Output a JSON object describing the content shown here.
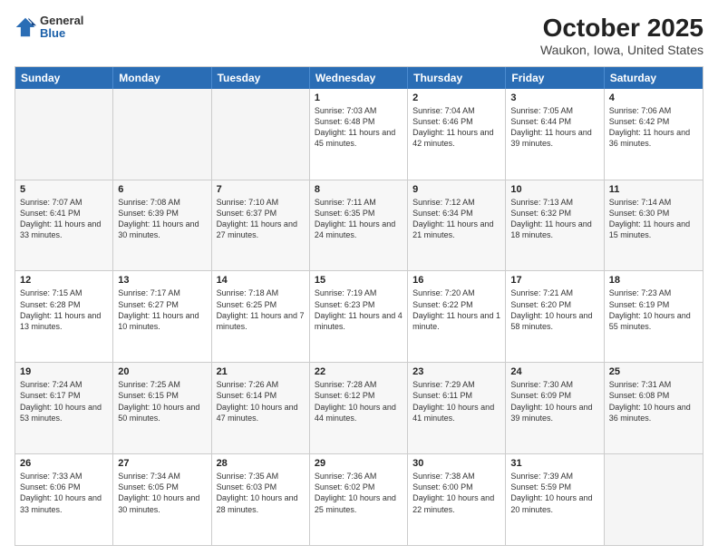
{
  "header": {
    "logo": {
      "general": "General",
      "blue": "Blue"
    },
    "title": "October 2025",
    "location": "Waukon, Iowa, United States"
  },
  "calendar": {
    "days_of_week": [
      "Sunday",
      "Monday",
      "Tuesday",
      "Wednesday",
      "Thursday",
      "Friday",
      "Saturday"
    ],
    "weeks": [
      [
        {
          "day": "",
          "empty": true
        },
        {
          "day": "",
          "empty": true
        },
        {
          "day": "",
          "empty": true
        },
        {
          "day": "1",
          "sunrise": "7:03 AM",
          "sunset": "6:48 PM",
          "daylight": "11 hours and 45 minutes."
        },
        {
          "day": "2",
          "sunrise": "7:04 AM",
          "sunset": "6:46 PM",
          "daylight": "11 hours and 42 minutes."
        },
        {
          "day": "3",
          "sunrise": "7:05 AM",
          "sunset": "6:44 PM",
          "daylight": "11 hours and 39 minutes."
        },
        {
          "day": "4",
          "sunrise": "7:06 AM",
          "sunset": "6:42 PM",
          "daylight": "11 hours and 36 minutes."
        }
      ],
      [
        {
          "day": "5",
          "sunrise": "7:07 AM",
          "sunset": "6:41 PM",
          "daylight": "11 hours and 33 minutes."
        },
        {
          "day": "6",
          "sunrise": "7:08 AM",
          "sunset": "6:39 PM",
          "daylight": "11 hours and 30 minutes."
        },
        {
          "day": "7",
          "sunrise": "7:10 AM",
          "sunset": "6:37 PM",
          "daylight": "11 hours and 27 minutes."
        },
        {
          "day": "8",
          "sunrise": "7:11 AM",
          "sunset": "6:35 PM",
          "daylight": "11 hours and 24 minutes."
        },
        {
          "day": "9",
          "sunrise": "7:12 AM",
          "sunset": "6:34 PM",
          "daylight": "11 hours and 21 minutes."
        },
        {
          "day": "10",
          "sunrise": "7:13 AM",
          "sunset": "6:32 PM",
          "daylight": "11 hours and 18 minutes."
        },
        {
          "day": "11",
          "sunrise": "7:14 AM",
          "sunset": "6:30 PM",
          "daylight": "11 hours and 15 minutes."
        }
      ],
      [
        {
          "day": "12",
          "sunrise": "7:15 AM",
          "sunset": "6:28 PM",
          "daylight": "11 hours and 13 minutes."
        },
        {
          "day": "13",
          "sunrise": "7:17 AM",
          "sunset": "6:27 PM",
          "daylight": "11 hours and 10 minutes."
        },
        {
          "day": "14",
          "sunrise": "7:18 AM",
          "sunset": "6:25 PM",
          "daylight": "11 hours and 7 minutes."
        },
        {
          "day": "15",
          "sunrise": "7:19 AM",
          "sunset": "6:23 PM",
          "daylight": "11 hours and 4 minutes."
        },
        {
          "day": "16",
          "sunrise": "7:20 AM",
          "sunset": "6:22 PM",
          "daylight": "11 hours and 1 minute."
        },
        {
          "day": "17",
          "sunrise": "7:21 AM",
          "sunset": "6:20 PM",
          "daylight": "10 hours and 58 minutes."
        },
        {
          "day": "18",
          "sunrise": "7:23 AM",
          "sunset": "6:19 PM",
          "daylight": "10 hours and 55 minutes."
        }
      ],
      [
        {
          "day": "19",
          "sunrise": "7:24 AM",
          "sunset": "6:17 PM",
          "daylight": "10 hours and 53 minutes."
        },
        {
          "day": "20",
          "sunrise": "7:25 AM",
          "sunset": "6:15 PM",
          "daylight": "10 hours and 50 minutes."
        },
        {
          "day": "21",
          "sunrise": "7:26 AM",
          "sunset": "6:14 PM",
          "daylight": "10 hours and 47 minutes."
        },
        {
          "day": "22",
          "sunrise": "7:28 AM",
          "sunset": "6:12 PM",
          "daylight": "10 hours and 44 minutes."
        },
        {
          "day": "23",
          "sunrise": "7:29 AM",
          "sunset": "6:11 PM",
          "daylight": "10 hours and 41 minutes."
        },
        {
          "day": "24",
          "sunrise": "7:30 AM",
          "sunset": "6:09 PM",
          "daylight": "10 hours and 39 minutes."
        },
        {
          "day": "25",
          "sunrise": "7:31 AM",
          "sunset": "6:08 PM",
          "daylight": "10 hours and 36 minutes."
        }
      ],
      [
        {
          "day": "26",
          "sunrise": "7:33 AM",
          "sunset": "6:06 PM",
          "daylight": "10 hours and 33 minutes."
        },
        {
          "day": "27",
          "sunrise": "7:34 AM",
          "sunset": "6:05 PM",
          "daylight": "10 hours and 30 minutes."
        },
        {
          "day": "28",
          "sunrise": "7:35 AM",
          "sunset": "6:03 PM",
          "daylight": "10 hours and 28 minutes."
        },
        {
          "day": "29",
          "sunrise": "7:36 AM",
          "sunset": "6:02 PM",
          "daylight": "10 hours and 25 minutes."
        },
        {
          "day": "30",
          "sunrise": "7:38 AM",
          "sunset": "6:00 PM",
          "daylight": "10 hours and 22 minutes."
        },
        {
          "day": "31",
          "sunrise": "7:39 AM",
          "sunset": "5:59 PM",
          "daylight": "10 hours and 20 minutes."
        },
        {
          "day": "",
          "empty": true
        }
      ]
    ]
  }
}
